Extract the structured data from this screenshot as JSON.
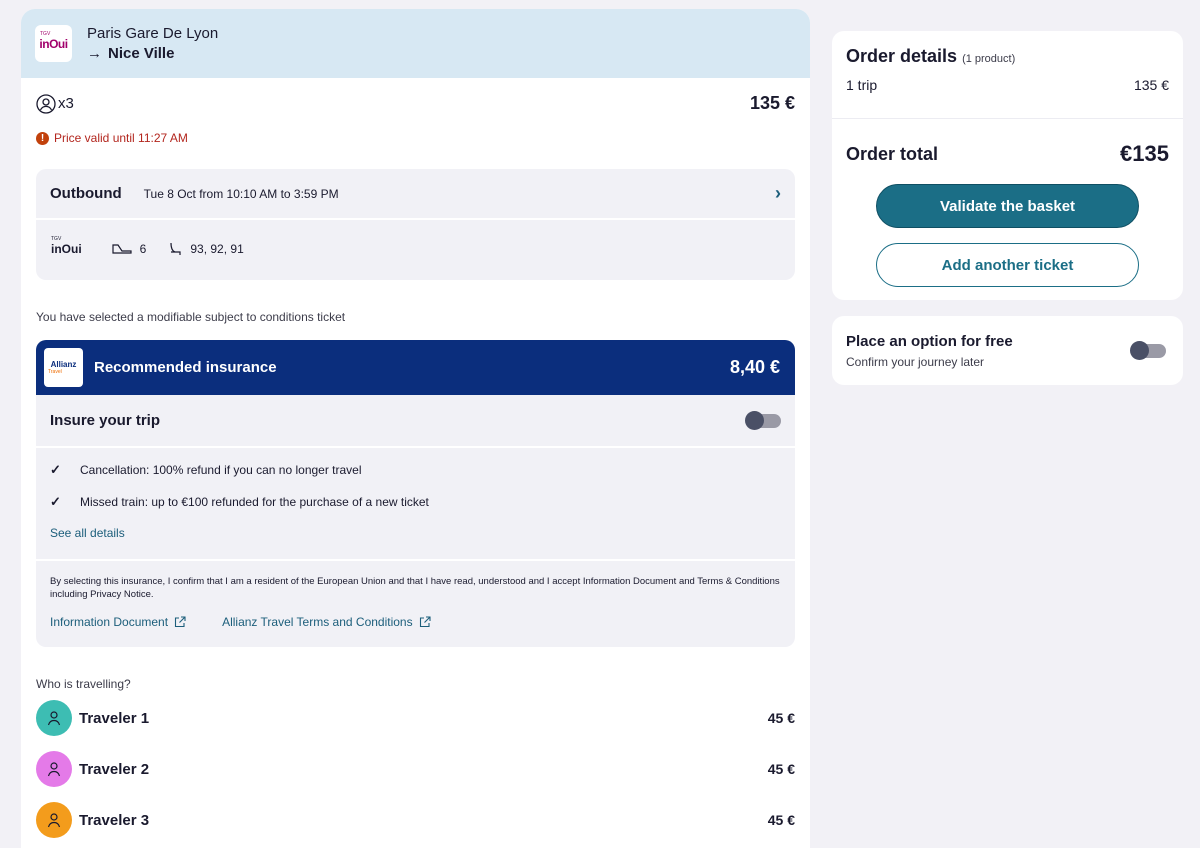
{
  "trip": {
    "logo_text": "inOui",
    "logo_sup": "TGV",
    "from": "Paris Gare De Lyon",
    "to": "Nice Ville",
    "arrow": "→"
  },
  "passengers": {
    "count": "x3",
    "price": "135 €"
  },
  "validity": {
    "icon": "!",
    "text": "Price valid until 11:27 AM"
  },
  "outbound": {
    "label": "Outbound",
    "time": "Tue 8 Oct from 10:10 AM to 3:59 PM",
    "brand": "inOui",
    "brand_sup": "TGV",
    "coach": "6",
    "seats": "93, 92, 91"
  },
  "ticket_note": "You have selected a modifiable subject to conditions ticket",
  "insurance": {
    "brand": "Allianz",
    "brand_sub": "Travel",
    "title": "Recommended insurance",
    "price": "8,40 €",
    "toggle_label": "Insure your trip",
    "toggle_on": false,
    "benefits": [
      "Cancellation: 100% refund if you can no longer travel",
      "Missed train: up to €100 refunded for the purchase of a new ticket"
    ],
    "see_all": "See all details",
    "legal": "By selecting this insurance, I confirm that I am a resident of the European Union and that I have read, understood and I accept Information Document and Terms & Conditions including Privacy Notice.",
    "link_info": "Information Document",
    "link_terms": "Allianz Travel Terms and Conditions"
  },
  "travellers": {
    "heading": "Who is travelling?",
    "list": [
      {
        "name": "Traveler 1",
        "price": "45 €",
        "color": "#3dbdb3"
      },
      {
        "name": "Traveler 2",
        "price": "45 €",
        "color": "#e47ae8"
      },
      {
        "name": "Traveler 3",
        "price": "45 €",
        "color": "#f39c1c"
      }
    ]
  },
  "order": {
    "title": "Order details",
    "count": "(1 product)",
    "line_label": "1 trip",
    "line_price": "135 €",
    "total_label": "Order total",
    "total_value": "€135",
    "validate": "Validate the basket",
    "add": "Add another ticket"
  },
  "option": {
    "title": "Place an option for free",
    "subtitle": "Confirm your journey later",
    "toggle_on": false
  },
  "colors": {
    "primary": "#1b6e86",
    "insurance": "#0b2e7d",
    "warning": "#b3261e"
  }
}
